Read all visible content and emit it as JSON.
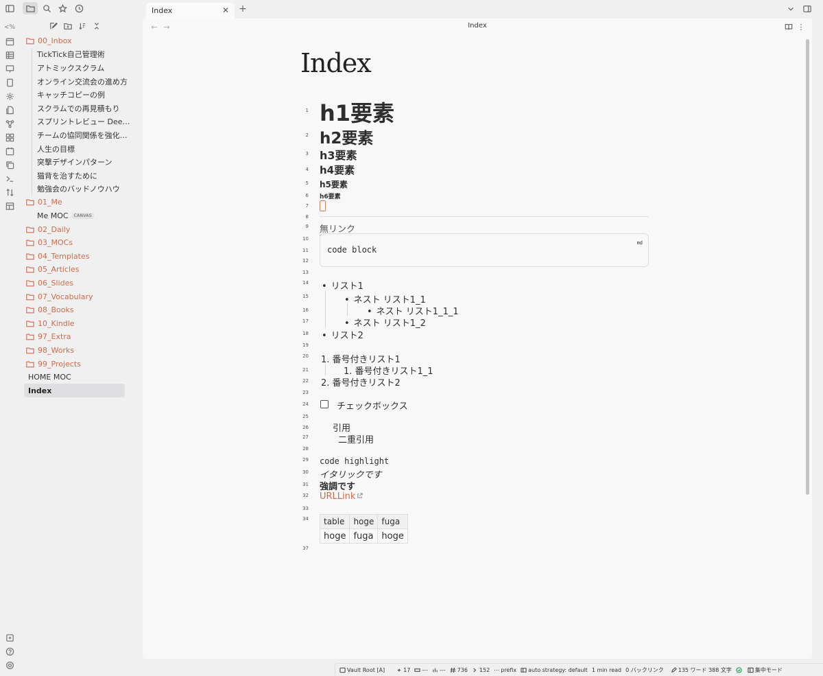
{
  "tab": {
    "title": "Index"
  },
  "pane": {
    "title": "Index",
    "inline_title": "Index"
  },
  "ribbon": {
    "toggle_text": "<%"
  },
  "tree": [
    {
      "type": "folder",
      "label": "00_Inbox"
    },
    {
      "type": "file",
      "label": "TickTick自己管理術",
      "child": true
    },
    {
      "type": "file",
      "label": "アトミックスクラム",
      "child": true
    },
    {
      "type": "file",
      "label": "オンライン交流会の進め方",
      "child": true
    },
    {
      "type": "file",
      "label": "キャッチコピーの例",
      "child": true
    },
    {
      "type": "file",
      "label": "スクラムでの再見積もり",
      "child": true
    },
    {
      "type": "file",
      "label": "スプリントレビュー Dee…",
      "child": true
    },
    {
      "type": "file",
      "label": "チームの協同関係を強化…",
      "child": true
    },
    {
      "type": "file",
      "label": "人生の目標",
      "child": true
    },
    {
      "type": "file",
      "label": "突撃デザインパターン",
      "child": true
    },
    {
      "type": "file",
      "label": "猫背を治すために",
      "child": true
    },
    {
      "type": "file",
      "label": "勉強会のバッドノウハウ",
      "child": true
    },
    {
      "type": "folder",
      "label": "01_Me"
    },
    {
      "type": "file",
      "label": "Me MOC",
      "badge": "CANVAS",
      "child": false
    },
    {
      "type": "folder",
      "label": "02_Daily"
    },
    {
      "type": "folder",
      "label": "03_MOCs"
    },
    {
      "type": "folder",
      "label": "04_Templates"
    },
    {
      "type": "folder",
      "label": "05_Articles"
    },
    {
      "type": "folder",
      "label": "06_Slides"
    },
    {
      "type": "folder",
      "label": "07_Vocabulary"
    },
    {
      "type": "folder",
      "label": "08_Books"
    },
    {
      "type": "folder",
      "label": "10_Kindle"
    },
    {
      "type": "folder",
      "label": "97_Extra"
    },
    {
      "type": "folder",
      "label": "98_Works"
    },
    {
      "type": "folder",
      "label": "99_Projects"
    },
    {
      "type": "root",
      "label": "HOME MOC"
    },
    {
      "type": "active",
      "label": "Index"
    }
  ],
  "editor": {
    "line_numbers": [
      "1",
      "2",
      "3",
      "4",
      "5",
      "6",
      "7",
      "8",
      "9",
      "10",
      "11",
      "12",
      "13",
      "14",
      "15",
      "16",
      "17",
      "18",
      "19",
      "20",
      "21",
      "22",
      "23",
      "24",
      "25",
      "26",
      "27",
      "28",
      "29",
      "30",
      "31",
      "32",
      "33",
      "34",
      "37"
    ],
    "h1": "h1要素",
    "h2": "h2要素",
    "h3": "h3要素",
    "h4": "h4要素",
    "h5": "h5要素",
    "h6": "h6要素",
    "no_link": "無リンク",
    "code_block": {
      "code": "code block",
      "lang": "md"
    },
    "list": {
      "item1": "リスト1",
      "nest1_1": "ネスト リスト1_1",
      "nest1_1_1": "ネスト リスト1_1_1",
      "nest1_2": "ネスト リスト1_2",
      "item2": "リスト2"
    },
    "ordered": {
      "item1": "1. 番号付きリスト1",
      "item1_1": "1. 番号付きリスト1_1",
      "item2": "2. 番号付きリスト2"
    },
    "checkbox": "チェックボックス",
    "quote1": "引用",
    "quote2": "二重引用",
    "code_highlight": "code highlight",
    "italic": "イタリックです",
    "bold": "強調です",
    "url_link": "URLLink",
    "table": {
      "header": [
        "table",
        "hoge",
        "fuga"
      ],
      "rows": [
        [
          "hoge",
          "fuga",
          "hoge"
        ]
      ]
    }
  },
  "status": {
    "vault": "Vault Root [A]",
    "s1": "17",
    "s2": "---",
    "s3": "---",
    "s4": "736",
    "s5": "152",
    "s6": "prefix",
    "s7": "auto strategy: default",
    "s8": "1 min read",
    "s9": "0 バックリンク",
    "s10": "135 ワード 388 文字",
    "s11": "集中モード"
  }
}
